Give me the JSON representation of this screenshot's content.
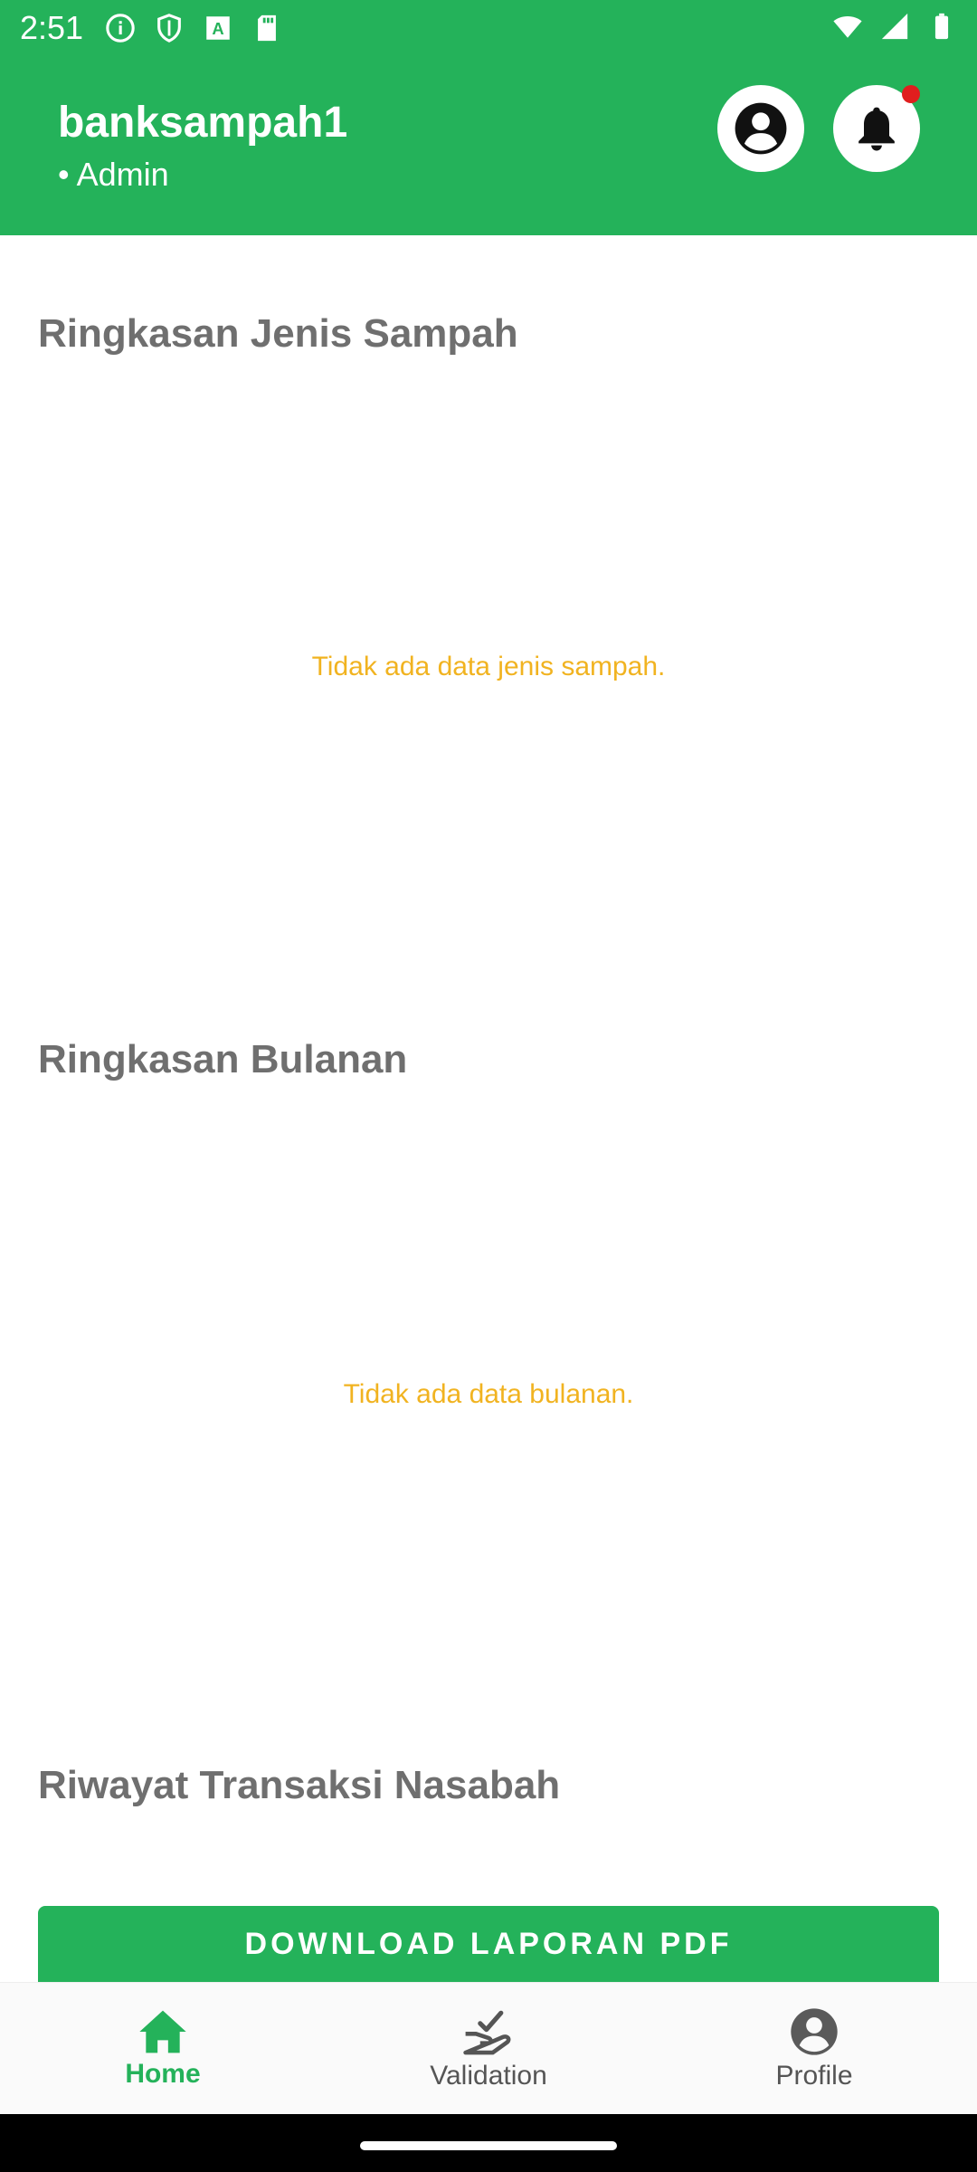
{
  "status_bar": {
    "time": "2:51",
    "left_icons": [
      "info-icon",
      "shield-icon",
      "a-box-icon",
      "sd-card-icon"
    ],
    "right_icons": [
      "wifi-icon",
      "signal-icon",
      "battery-icon"
    ]
  },
  "header": {
    "title": "banksampah1",
    "subtitle": "• Admin",
    "profile_icon": "account-circle-icon",
    "notification_icon": "bell-icon",
    "accent": "#24b25a"
  },
  "sections": [
    {
      "title": "Ringkasan Jenis Sampah",
      "empty_message": "Tidak ada data jenis sampah."
    },
    {
      "title": "Ringkasan Bulanan",
      "empty_message": "Tidak ada data bulanan."
    },
    {
      "title": "Riwayat Transaksi Nasabah"
    }
  ],
  "download_button": {
    "label": "DOWNLOAD LAPORAN PDF"
  },
  "bottom_nav": {
    "items": [
      {
        "label": "Home",
        "icon": "home-icon",
        "active": true
      },
      {
        "label": "Validation",
        "icon": "validation-hand-icon",
        "active": false
      },
      {
        "label": "Profile",
        "icon": "account-circle-icon",
        "active": false
      }
    ]
  },
  "colors": {
    "primary": "#24b25a",
    "empty_text": "#f1b320",
    "notification_dot": "#e01e1e"
  }
}
